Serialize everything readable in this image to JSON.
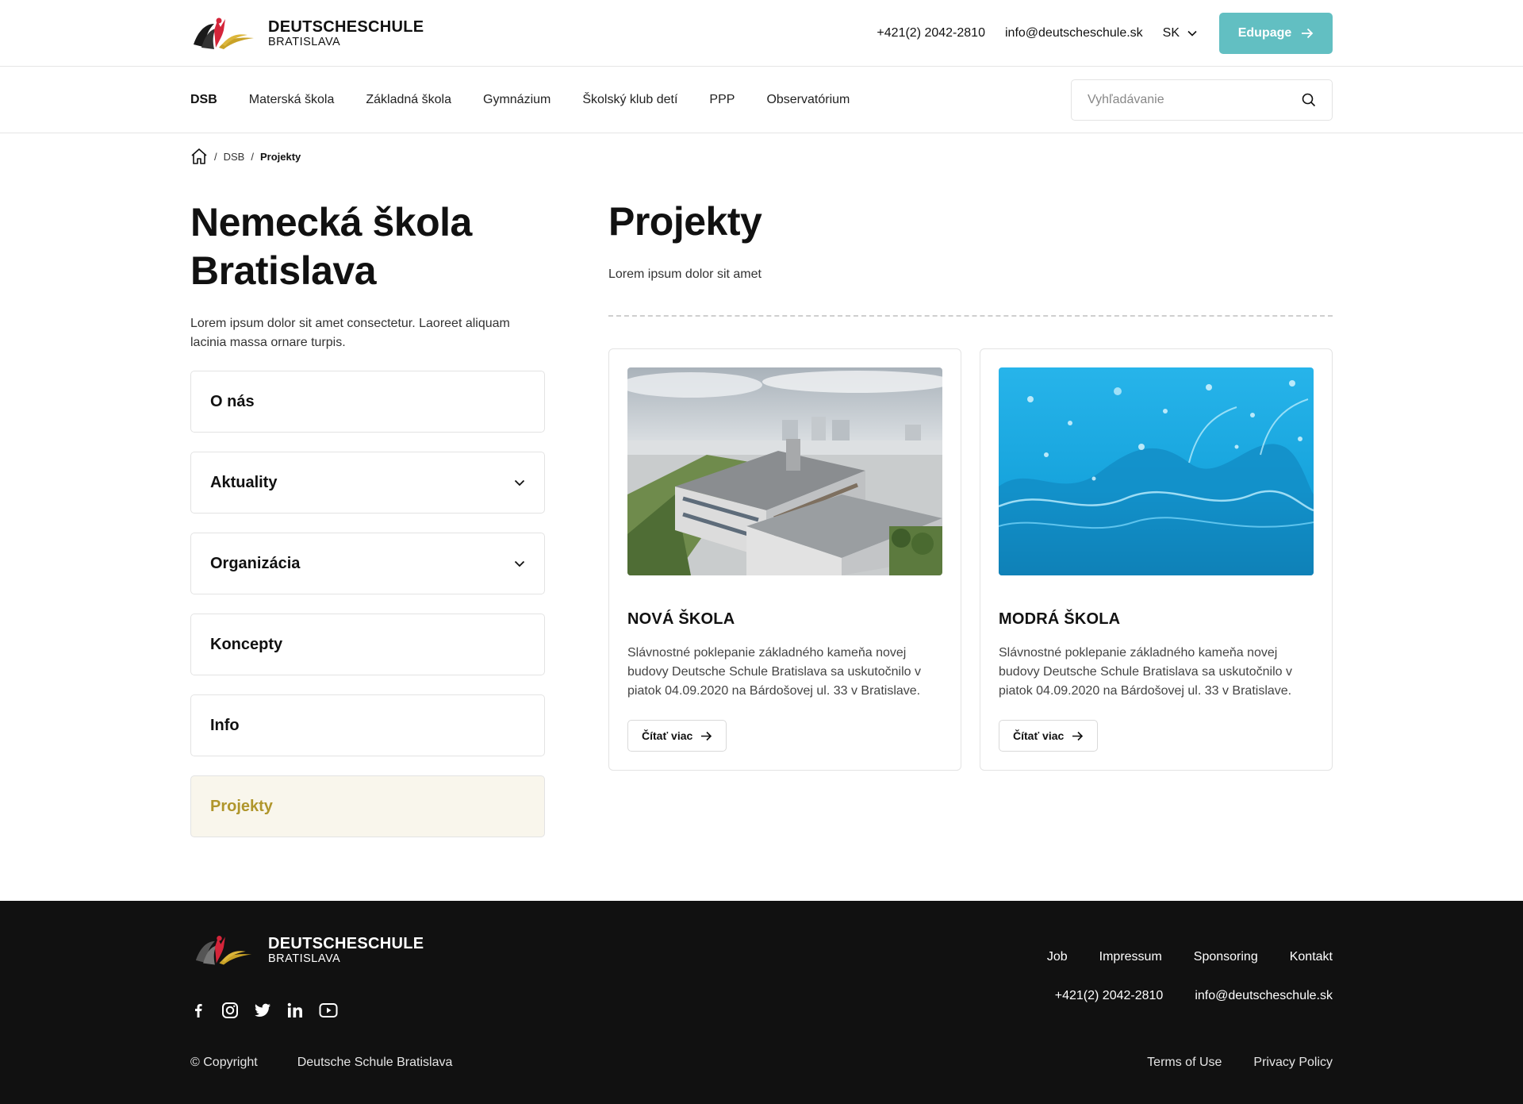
{
  "header": {
    "logo_line1": "DEUTSCHESCHULE",
    "logo_line2": "BRATISLAVA",
    "phone": "+421(2) 2042-2810",
    "email": "info@deutscheschule.sk",
    "language": "SK",
    "edupage_label": "Edupage",
    "accent_color": "#62bfc2"
  },
  "nav": {
    "items": [
      {
        "label": "DSB",
        "active": true
      },
      {
        "label": "Materská škola"
      },
      {
        "label": "Základná škola"
      },
      {
        "label": "Gymnázium"
      },
      {
        "label": "Školský klub detí"
      },
      {
        "label": "PPP"
      },
      {
        "label": "Observatórium"
      }
    ],
    "search_placeholder": "Vyhľadávanie"
  },
  "breadcrumb": {
    "items": [
      "DSB",
      "Projekty"
    ]
  },
  "sidebar": {
    "title": "Nemecká škola Bratislava",
    "description": "Lorem ipsum dolor sit amet consectetur. Laoreet aliquam lacinia massa ornare turpis.",
    "items": [
      {
        "label": "O nás",
        "expandable": false
      },
      {
        "label": "Aktuality",
        "expandable": true
      },
      {
        "label": "Organizácia",
        "expandable": true
      },
      {
        "label": "Koncepty",
        "expandable": false
      },
      {
        "label": "Info",
        "expandable": false
      },
      {
        "label": "Projekty",
        "expandable": false,
        "active": true
      }
    ],
    "active_color": "#b0962c"
  },
  "main": {
    "title": "Projekty",
    "subtitle": "Lorem ipsum dolor sit amet",
    "cards": [
      {
        "title": "NOVÁ ŠKOLA",
        "text": "Slávnostné poklepanie základného kameňa novej budovy Deutsche Schule Bratislava sa uskutočnilo v piatok 04.09.2020 na Bárdošovej ul. 33 v Bratislave.",
        "button": "Čítať viac"
      },
      {
        "title": "MODRÁ ŠKOLA",
        "text": "Slávnostné poklepanie základného kameňa novej budovy Deutsche Schule Bratislava sa uskutočnilo v piatok 04.09.2020 na Bárdošovej ul. 33 v Bratislave.",
        "button": "Čítať viac"
      }
    ]
  },
  "footer": {
    "logo_line1": "DEUTSCHESCHULE",
    "logo_line2": "BRATISLAVA",
    "social_icons": [
      "facebook-icon",
      "instagram-icon",
      "twitter-icon",
      "linkedin-icon",
      "youtube-icon"
    ],
    "links": [
      "Job",
      "Impressum",
      "Sponsoring",
      "Kontakt"
    ],
    "phone": "+421(2) 2042-2810",
    "email": "info@deutscheschule.sk",
    "copyright": "© Copyright",
    "company": "Deutsche Schule Bratislava",
    "terms": "Terms of Use",
    "privacy": "Privacy Policy"
  }
}
